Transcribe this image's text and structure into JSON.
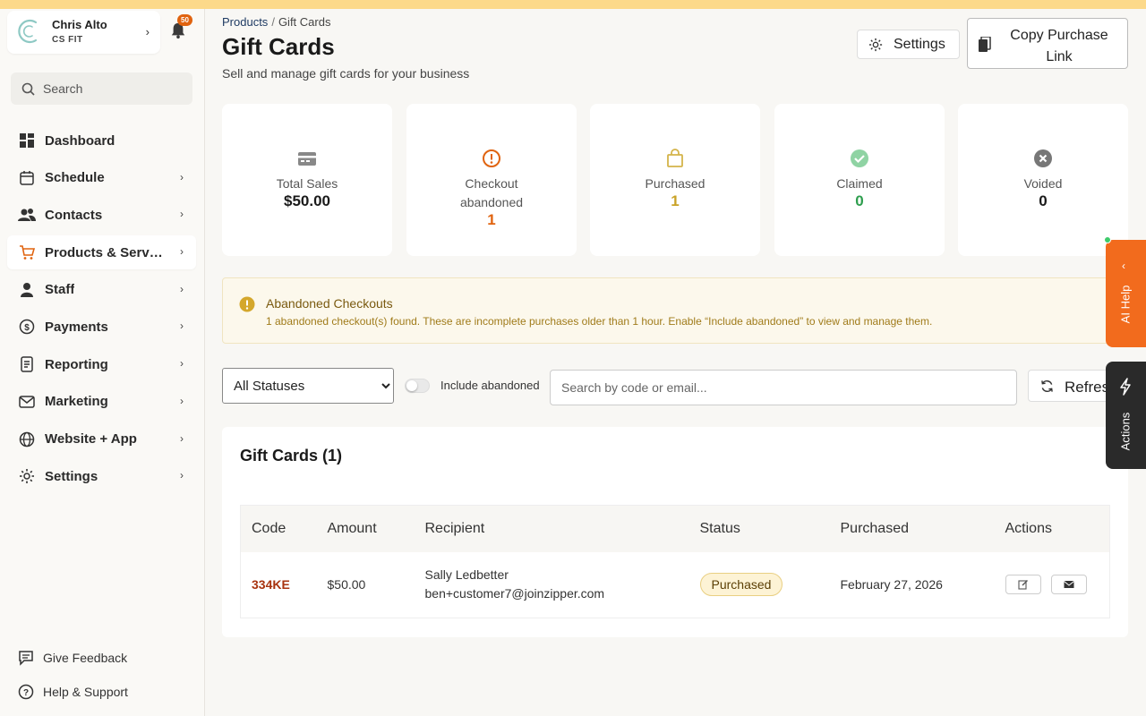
{
  "account": {
    "name": "Chris Alto",
    "org": "CS FIT",
    "notification_count": "50"
  },
  "sidebar": {
    "search_placeholder": "Search",
    "items": [
      {
        "label": "Dashboard",
        "icon": "dashboard-icon",
        "has_chevron": false
      },
      {
        "label": "Schedule",
        "icon": "calendar-icon",
        "has_chevron": true
      },
      {
        "label": "Contacts",
        "icon": "users-icon",
        "has_chevron": true
      },
      {
        "label": "Products & Servi...",
        "icon": "cart-icon",
        "has_chevron": true,
        "active": true
      },
      {
        "label": "Staff",
        "icon": "person-icon",
        "has_chevron": true
      },
      {
        "label": "Payments",
        "icon": "dollar-icon",
        "has_chevron": true
      },
      {
        "label": "Reporting",
        "icon": "report-icon",
        "has_chevron": true
      },
      {
        "label": "Marketing",
        "icon": "mail-icon",
        "has_chevron": true
      },
      {
        "label": "Website + App",
        "icon": "globe-icon",
        "has_chevron": true
      },
      {
        "label": "Settings",
        "icon": "gear-icon",
        "has_chevron": true
      }
    ],
    "feedback_label": "Give Feedback",
    "help_label": "Help & Support"
  },
  "breadcrumb": {
    "parent": "Products",
    "sep": "/",
    "current": "Gift Cards"
  },
  "header": {
    "title": "Gift Cards",
    "subtitle": "Sell and manage gift cards for your business",
    "settings_label": "Settings",
    "copy_label": "Copy Purchase Link"
  },
  "stats": [
    {
      "label": "Total Sales",
      "value": "$50.00",
      "color": "#1a1a1a",
      "icon": "credit-card-icon"
    },
    {
      "label": "Checkout abandoned",
      "value": "1",
      "color": "#e0630f",
      "icon": "alert-circle-icon"
    },
    {
      "label": "Purchased",
      "value": "1",
      "color": "#c9a227",
      "icon": "shopping-bag-icon"
    },
    {
      "label": "Claimed",
      "value": "0",
      "color": "#2e9e4e",
      "icon": "check-circle-icon"
    },
    {
      "label": "Voided",
      "value": "0",
      "color": "#1a1a1a",
      "icon": "x-circle-icon"
    }
  ],
  "alert": {
    "title": "Abandoned Checkouts",
    "text": "1 abandoned checkout(s) found. These are incomplete purchases older than 1 hour. Enable “Include abandoned” to view and manage them."
  },
  "filters": {
    "status_selected": "All Statuses",
    "include_abandoned_label": "Include abandoned",
    "include_abandoned_on": false,
    "search_placeholder": "Search by code or email...",
    "refresh_label": "Refresh"
  },
  "table": {
    "title": "Gift Cards (1)",
    "columns": [
      "Code",
      "Amount",
      "Recipient",
      "Status",
      "Purchased",
      "Actions"
    ],
    "rows": [
      {
        "code": "334KE",
        "amount": "$50.00",
        "recipient_name": "Sally Ledbetter",
        "recipient_email": "ben+customer7@joinzipper.com",
        "status": "Purchased",
        "purchased": "February 27, 2026"
      }
    ]
  },
  "floating": {
    "ai_help_label": "AI Help",
    "actions_label": "Actions"
  },
  "colors": {
    "accent": "#f26b1d",
    "topbar": "#fcd98a"
  }
}
